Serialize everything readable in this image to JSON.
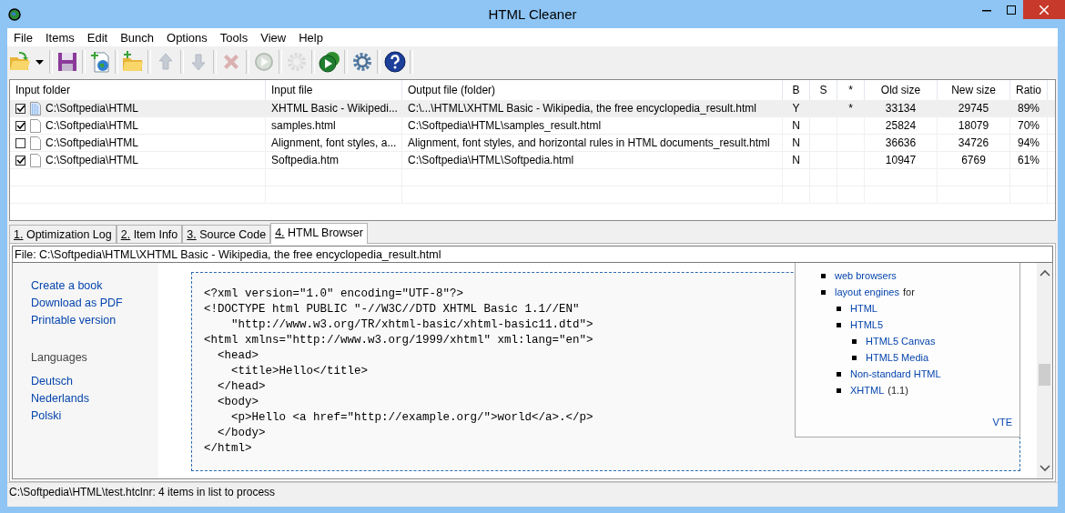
{
  "window": {
    "title": "HTML Cleaner"
  },
  "menu": [
    "File",
    "Items",
    "Edit",
    "Bunch",
    "Options",
    "Tools",
    "View",
    "Help"
  ],
  "toolbar": [
    {
      "kind": "open",
      "disabled": false
    },
    {
      "kind": "save",
      "disabled": false
    },
    {
      "kind": "add-web",
      "disabled": false
    },
    {
      "kind": "add-folder",
      "disabled": false
    },
    {
      "kind": "up",
      "disabled": true
    },
    {
      "kind": "down",
      "disabled": true
    },
    {
      "kind": "delete",
      "disabled": true
    },
    {
      "kind": "run",
      "disabled": true
    },
    {
      "kind": "gear",
      "disabled": true
    },
    {
      "kind": "run-all",
      "disabled": false
    },
    {
      "kind": "settings",
      "disabled": false
    },
    {
      "kind": "help",
      "disabled": false
    }
  ],
  "table": {
    "columns": [
      "Input folder",
      "Input file",
      "Output file (folder)",
      "B",
      "S",
      "*",
      "Old size",
      "New size",
      "Ratio"
    ],
    "rows": [
      {
        "checked": true,
        "selected": true,
        "cells": [
          "C:\\Softpedia\\HTML",
          "XHTML Basic - Wikipedi...",
          "C:\\...\\HTML\\XHTML Basic - Wikipedia, the free encyclopedia_result.html",
          "Y",
          "",
          "*",
          "33134",
          "29745",
          "89%"
        ]
      },
      {
        "checked": true,
        "selected": false,
        "cells": [
          "C:\\Softpedia\\HTML",
          "samples.html",
          "C:\\Softpedia\\HTML\\samples_result.html",
          "N",
          "",
          "",
          "25824",
          "18079",
          "70%"
        ]
      },
      {
        "checked": false,
        "selected": false,
        "cells": [
          "C:\\Softpedia\\HTML",
          "Alignment, font styles, a...",
          "Alignment, font styles, and horizontal rules in HTML documents_result.html",
          "N",
          "",
          "",
          "36636",
          "34726",
          "94%"
        ]
      },
      {
        "checked": true,
        "selected": false,
        "cells": [
          "C:\\Softpedia\\HTML",
          "Softpedia.htm",
          "C:\\Softpedia\\HTML\\Softpedia.html",
          "N",
          "",
          "",
          "10947",
          "6769",
          "61%"
        ]
      }
    ]
  },
  "tabs": [
    {
      "label": "1. Optimization Log",
      "selected": false
    },
    {
      "label": "2. Item Info",
      "selected": false
    },
    {
      "label": "3. Source Code",
      "selected": false
    },
    {
      "label": "4. HTML Browser",
      "selected": true
    }
  ],
  "file_line": "File: C:\\Softpedia\\HTML\\XHTML Basic - Wikipedia, the free encyclopedia_result.html",
  "browser": {
    "sidebar_links": [
      "Create a book",
      "Download as PDF",
      "Printable version"
    ],
    "languages_heading": "Languages",
    "language_links": [
      "Deutsch",
      "Nederlands",
      "Polski"
    ],
    "code": [
      "<?xml version=\"1.0\" encoding=\"UTF-8\"?>",
      "<!DOCTYPE html PUBLIC \"-//W3C//DTD XHTML Basic 1.1//EN\"",
      "    \"http://www.w3.org/TR/xhtml-basic/xhtml-basic11.dtd\">",
      "<html xmlns=\"http://www.w3.org/1999/xhtml\" xml:lang=\"en\">",
      "  <head>",
      "    <title>Hello</title>",
      "  </head>",
      "  <body>",
      "    <p>Hello <a href=\"http://example.org/\">world</a>.</p>",
      "  </body>",
      "</html>"
    ],
    "navbox": {
      "items": [
        {
          "text": "web browsers"
        },
        {
          "text": "layout engines",
          "suffix": "for",
          "children": [
            {
              "text": "HTML"
            },
            {
              "text": "HTML5",
              "children": [
                {
                  "text": "HTML5 Canvas"
                },
                {
                  "text": "HTML5 Media"
                }
              ]
            },
            {
              "text": "Non-standard HTML"
            },
            {
              "text": "XHTML",
              "suffix": "(1.1)"
            }
          ]
        }
      ],
      "footer": "VTE"
    }
  },
  "status_bar": "C:\\Softpedia\\HTML\\test.htclnr: 4 items in list to process"
}
